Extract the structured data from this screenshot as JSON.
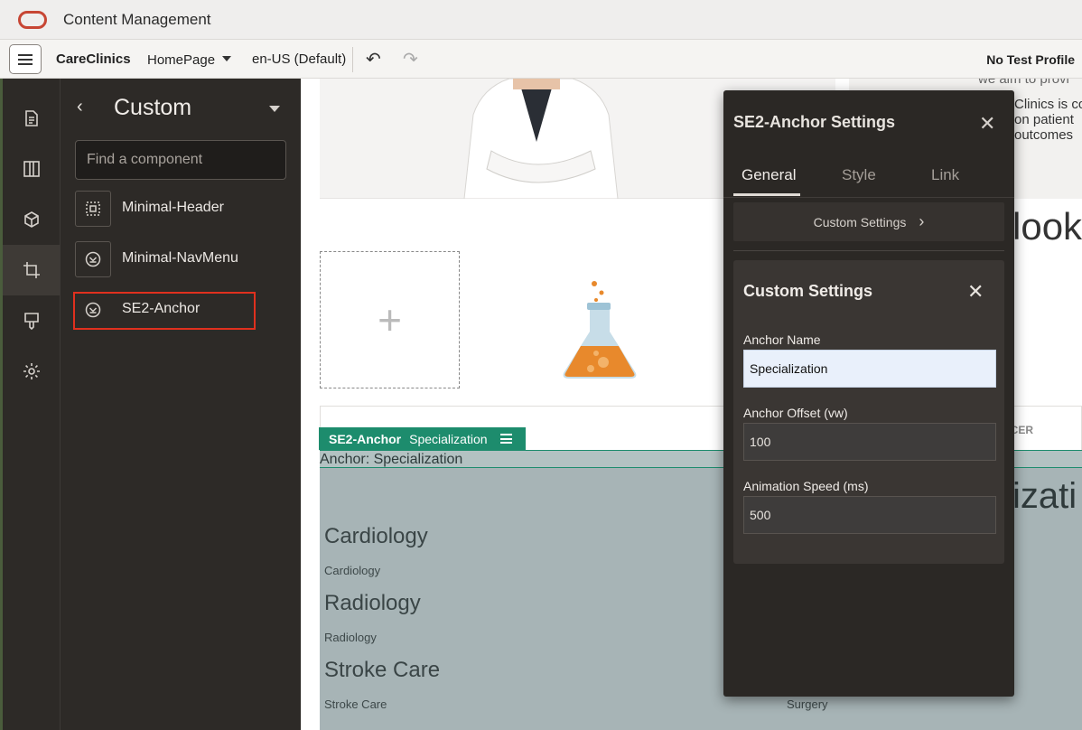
{
  "app": {
    "title": "Content Management"
  },
  "toolbar": {
    "site": "CareClinics",
    "page": "HomePage",
    "locale": "en-US (Default)",
    "undo_icon": "undo-icon",
    "redo_icon": "redo-icon",
    "test_profile": "No Test Profile"
  },
  "rail": {
    "items": [
      {
        "name": "pages-icon"
      },
      {
        "name": "layout-icon"
      },
      {
        "name": "components-icon"
      },
      {
        "name": "crop-icon",
        "active": true
      },
      {
        "name": "theme-icon"
      },
      {
        "name": "settings-icon"
      }
    ]
  },
  "panel": {
    "title": "Custom",
    "search_placeholder": "Find a component",
    "components": [
      {
        "label": "Minimal-Header",
        "icon": "header-component-icon"
      },
      {
        "label": "Minimal-NavMenu",
        "icon": "chevron-circle-icon"
      },
      {
        "label": "SE2-Anchor",
        "icon": "chevron-circle-icon",
        "highlighted": true
      }
    ]
  },
  "canvas": {
    "hero_text_1": "we aim to provi",
    "hero_text_2": "Clinics is co",
    "hero_text_3": "on patient",
    "hero_text_4": "outcomes",
    "look_text": "look",
    "spacer_label": "ACER",
    "anchor_tag": {
      "name": "SE2-Anchor",
      "value": "Specialization"
    },
    "anchor_bar": "Anchor: Specialization",
    "specializations": [
      {
        "title": "Cardiology",
        "subtitle": "Cardiology"
      },
      {
        "title": "Radiology",
        "subtitle": "Radiology"
      },
      {
        "title": "Stroke Care",
        "subtitle": "Stroke Care"
      }
    ],
    "izati_text": "izati",
    "surgery_text": "Surgery"
  },
  "dialog": {
    "title": "SE2-Anchor Settings",
    "tabs": [
      "General",
      "Style",
      "Link"
    ],
    "active_tab": "General",
    "custom_settings_label": "Custom Settings",
    "sub": {
      "title": "Custom Settings",
      "fields": [
        {
          "label": "Anchor Name",
          "value": "Specialization"
        },
        {
          "label": "Anchor Offset (vw)",
          "value": "100"
        },
        {
          "label": "Animation Speed (ms)",
          "value": "500"
        }
      ]
    }
  },
  "colors": {
    "brand_red": "#c74634",
    "anchor_green": "#1d8c6d",
    "highlight_red": "#e0301e",
    "dark_panel": "#2d2a27"
  }
}
